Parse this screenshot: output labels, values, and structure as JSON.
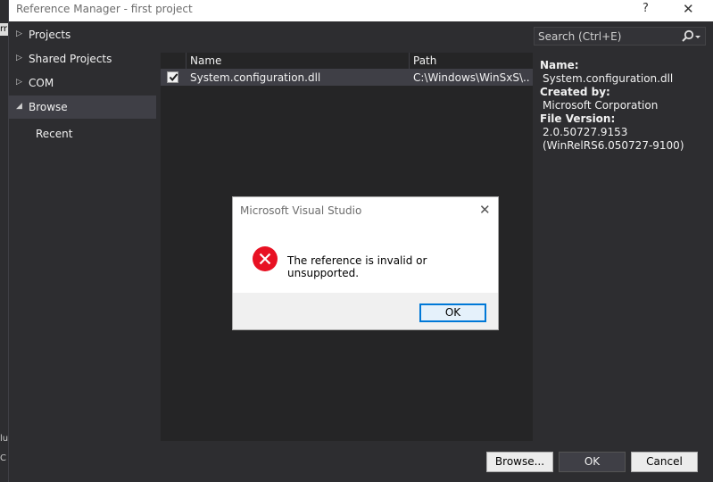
{
  "window": {
    "title": "Reference Manager - first project",
    "help_glyph": "?",
    "close_glyph": "✕"
  },
  "nav": {
    "items": [
      {
        "label": "Projects",
        "arrow": "▷",
        "selected": false
      },
      {
        "label": "Shared Projects",
        "arrow": "▷",
        "selected": false
      },
      {
        "label": "COM",
        "arrow": "▷",
        "selected": false
      },
      {
        "label": "Browse",
        "arrow": "◢",
        "selected": true
      },
      {
        "label": "Recent",
        "arrow": "",
        "selected": false
      }
    ]
  },
  "search": {
    "placeholder": "Search (Ctrl+E)",
    "icon": "search-icon"
  },
  "table": {
    "columns": [
      "Name",
      "Path"
    ],
    "rows": [
      {
        "checked": true,
        "name": "System.configuration.dll",
        "path": "C:\\Windows\\WinSxS\\..."
      }
    ]
  },
  "details": {
    "name_label": "Name:",
    "name_value": "System.configuration.dll",
    "created_label": "Created by:",
    "created_value": "Microsoft Corporation",
    "version_label": "File Version:",
    "version_value": "2.0.50727.9153",
    "version_build": "(WinRelRS6.050727-9100)"
  },
  "buttons": {
    "browse": "Browse...",
    "ok": "OK",
    "cancel": "Cancel"
  },
  "modal": {
    "title": "Microsoft Visual Studio",
    "close_glyph": "✕",
    "message": "The reference is invalid or unsupported.",
    "ok": "OK",
    "icon": "error-icon",
    "icon_color": "#e81123"
  },
  "background": {
    "fragment1": "rr",
    "fragment2": "lu",
    "fragment3": "C"
  },
  "colors": {
    "window_bg": "#2d2d30",
    "list_bg": "#252526",
    "selection": "#3f3f46",
    "focus_border": "#0078d7"
  }
}
